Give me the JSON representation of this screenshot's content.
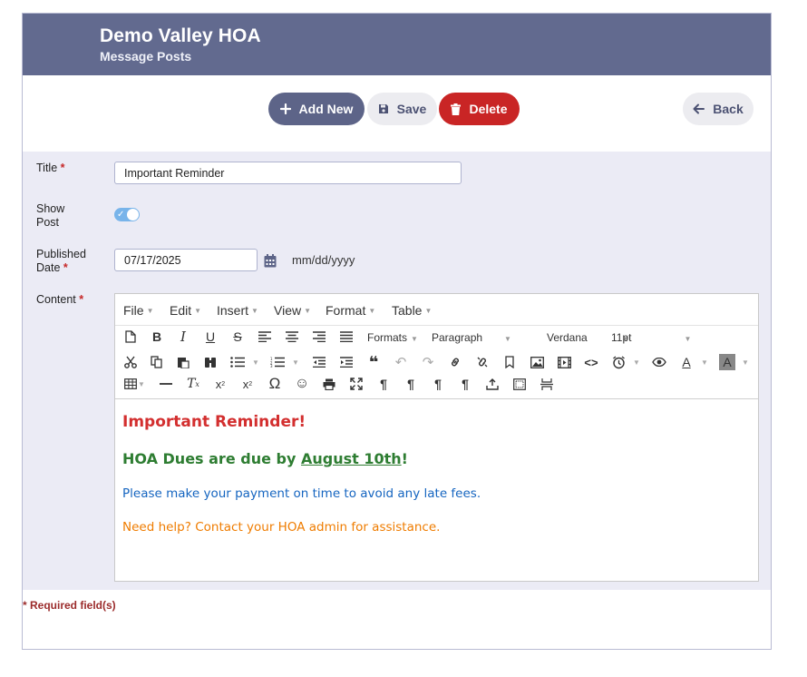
{
  "header": {
    "title": "Demo Valley HOA",
    "subtitle": "Message Posts"
  },
  "toolbar": {
    "add_label": "Add New",
    "save_label": "Save",
    "delete_label": "Delete",
    "back_label": "Back"
  },
  "form": {
    "title_label": "Title",
    "title_value": "Important Reminder",
    "show_label_line1": "Show",
    "show_label_line2": "Post",
    "show_post": true,
    "published_label_line1": "Published",
    "published_label_line2": "Date",
    "published_value": "07/17/2025",
    "date_format_hint": "mm/dd/yyyy",
    "content_label": "Content",
    "required_marker": "*"
  },
  "editor": {
    "menus": [
      "File",
      "Edit",
      "Insert",
      "View",
      "Format",
      "Table"
    ],
    "formats_label": "Formats",
    "block_label": "Paragraph",
    "font_label": "Verdana",
    "size_label": "11pt",
    "content": {
      "heading": "Important Reminder!",
      "subheading_prefix": "HOA Dues are due by ",
      "subheading_date": "August 10th",
      "subheading_suffix": "!",
      "paragraph1": "Please make your payment on time to avoid any late fees.",
      "paragraph2": "Need help? Contact your HOA admin for assistance."
    }
  },
  "footer": {
    "required_note": "* Required field(s)"
  },
  "colors": {
    "header_bg": "#626a8f",
    "add_btn": "#5d6488",
    "delete_btn": "#c92525",
    "form_bg": "#ebebf5",
    "heading_red": "#d32f2f",
    "subheading_green": "#2e7d32",
    "paragraph_blue": "#1565c0",
    "paragraph_orange": "#ef7c00"
  }
}
